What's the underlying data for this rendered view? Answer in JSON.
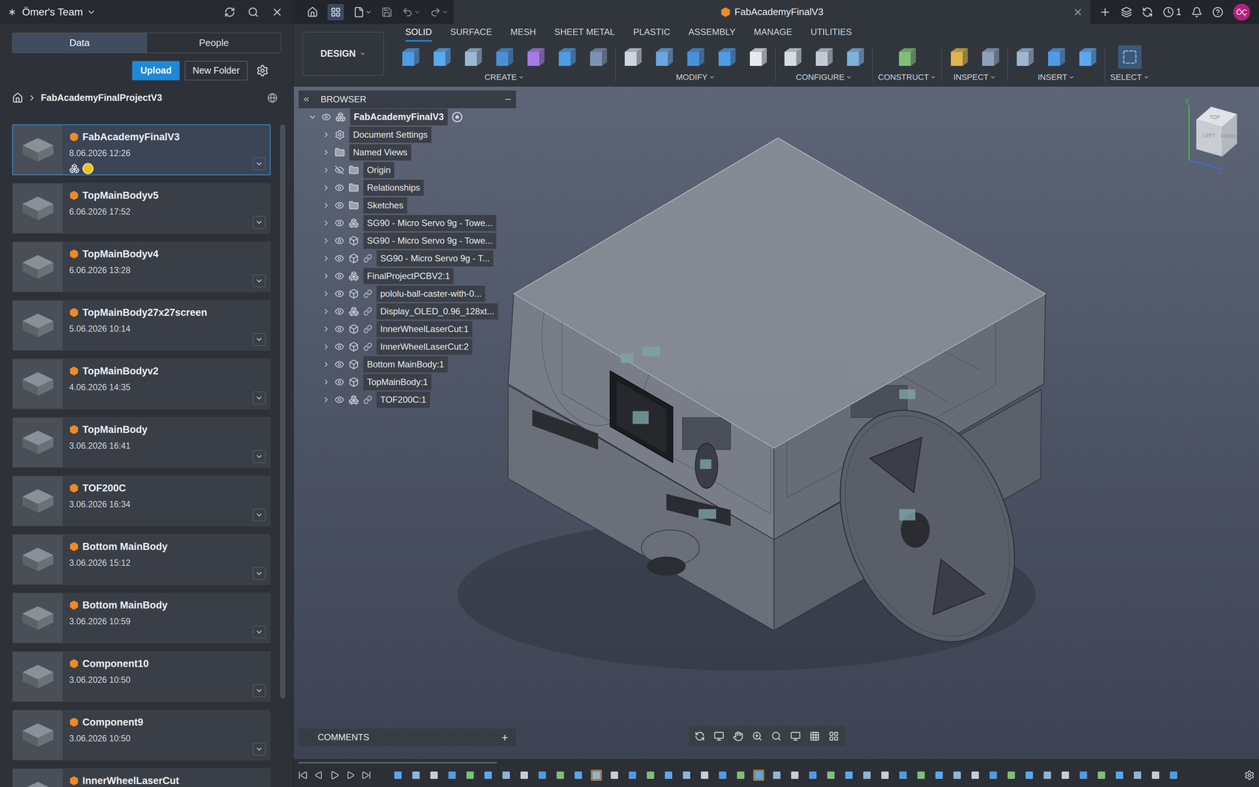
{
  "header": {
    "team": "Ömer's Team",
    "document_title": "FabAcademyFinalV3",
    "job_count": "1",
    "avatar": "ÖÇ"
  },
  "left_tabs": [
    {
      "label": "Data",
      "selected": true
    },
    {
      "label": "People",
      "selected": false
    }
  ],
  "buttons": [
    "Upload",
    "New Folder"
  ],
  "breadcrumb": "FabAcademyFinalProjectV3",
  "files": [
    {
      "name": "FabAcademyFinalV3",
      "date": "8.06.2026 12:26",
      "selected": true
    },
    {
      "name": "TopMainBodyv5",
      "date": "6.06.2026 17:52",
      "selected": false
    },
    {
      "name": "TopMainBodyv4",
      "date": "6.06.2026 13:28",
      "selected": false
    },
    {
      "name": "TopMainBody27x27screen",
      "date": "5.06.2026 10:14",
      "selected": false
    },
    {
      "name": "TopMainBodyv2",
      "date": "4.06.2026 14:35",
      "selected": false
    },
    {
      "name": "TopMainBody",
      "date": "3.06.2026 16:41",
      "selected": false
    },
    {
      "name": "TOF200C",
      "date": "3.06.2026 16:34",
      "selected": false
    },
    {
      "name": "Bottom MainBody",
      "date": "3.06.2026 15:12",
      "selected": false
    },
    {
      "name": "Bottom MainBody",
      "date": "3.06.2026 10:59",
      "selected": false
    },
    {
      "name": "Component10",
      "date": "3.06.2026 10:50",
      "selected": false
    },
    {
      "name": "Component9",
      "date": "3.06.2026 10:50",
      "selected": false
    },
    {
      "name": "InnerWheelLaserCut",
      "date": null,
      "selected": false
    }
  ],
  "design_button": "DESIGN",
  "toolbar_tabs": [
    {
      "label": "SOLID",
      "selected": true
    },
    {
      "label": "SURFACE",
      "selected": false
    },
    {
      "label": "MESH",
      "selected": false
    },
    {
      "label": "SHEET METAL",
      "selected": false
    },
    {
      "label": "PLASTIC",
      "selected": false
    },
    {
      "label": "ASSEMBLY",
      "selected": false
    },
    {
      "label": "MANAGE",
      "selected": false
    },
    {
      "label": "UTILITIES",
      "selected": false
    }
  ],
  "toolbar_groups": [
    "CREATE",
    "MODIFY",
    "CONFIGURE",
    "CONSTRUCT",
    "INSPECT",
    "INSERT",
    "SELECT"
  ],
  "browser": {
    "title": "BROWSER",
    "root": {
      "label": "FabAcademyFinalV3",
      "expanded": true
    },
    "items": [
      {
        "label": "Document Settings",
        "kind": "settings",
        "has_eye": false,
        "visible": true,
        "linked": false
      },
      {
        "label": "Named Views",
        "kind": "folder",
        "has_eye": false,
        "visible": true,
        "linked": false
      },
      {
        "label": "Origin",
        "kind": "folder",
        "has_eye": true,
        "visible": false,
        "linked": false
      },
      {
        "label": "Relationships",
        "kind": "folder",
        "has_eye": true,
        "visible": true,
        "linked": false
      },
      {
        "label": "Sketches",
        "kind": "folder",
        "has_eye": true,
        "visible": true,
        "linked": false
      },
      {
        "label": "SG90 - Micro Servo 9g - Towe...",
        "kind": "assembly",
        "has_eye": true,
        "visible": true,
        "linked": false
      },
      {
        "label": "SG90 - Micro Servo 9g - Towe...",
        "kind": "component",
        "has_eye": true,
        "visible": true,
        "linked": false
      },
      {
        "label": "SG90 - Micro Servo 9g - T...",
        "kind": "component",
        "has_eye": true,
        "visible": true,
        "linked": true
      },
      {
        "label": "FinalProjectPCBV2:1",
        "kind": "assembly",
        "has_eye": true,
        "visible": true,
        "linked": false
      },
      {
        "label": "pololu-ball-caster-with-0...",
        "kind": "component",
        "has_eye": true,
        "visible": true,
        "linked": true
      },
      {
        "label": "Display_OLED_0.96_128xt...",
        "kind": "assembly",
        "has_eye": true,
        "visible": true,
        "linked": true
      },
      {
        "label": "InnerWheelLaserCut:1",
        "kind": "component",
        "has_eye": true,
        "visible": true,
        "linked": true
      },
      {
        "label": "InnerWheelLaserCut:2",
        "kind": "component",
        "has_eye": true,
        "visible": true,
        "linked": true
      },
      {
        "label": "Bottom MainBody:1",
        "kind": "component",
        "has_eye": true,
        "visible": true,
        "linked": false
      },
      {
        "label": "TopMainBody:1",
        "kind": "component",
        "has_eye": true,
        "visible": true,
        "linked": false
      },
      {
        "label": "TOF200C:1",
        "kind": "assembly",
        "has_eye": true,
        "visible": true,
        "linked": true
      }
    ]
  },
  "comments": {
    "title": "COMMENTS",
    "add": "+"
  },
  "viewcube": {
    "faces": [
      "TOP",
      "FRONT",
      "LEFT"
    ],
    "axes": [
      "Y",
      "Z"
    ]
  },
  "timeline": {
    "feature_count": 44,
    "highlighted": [
      11,
      20
    ]
  }
}
